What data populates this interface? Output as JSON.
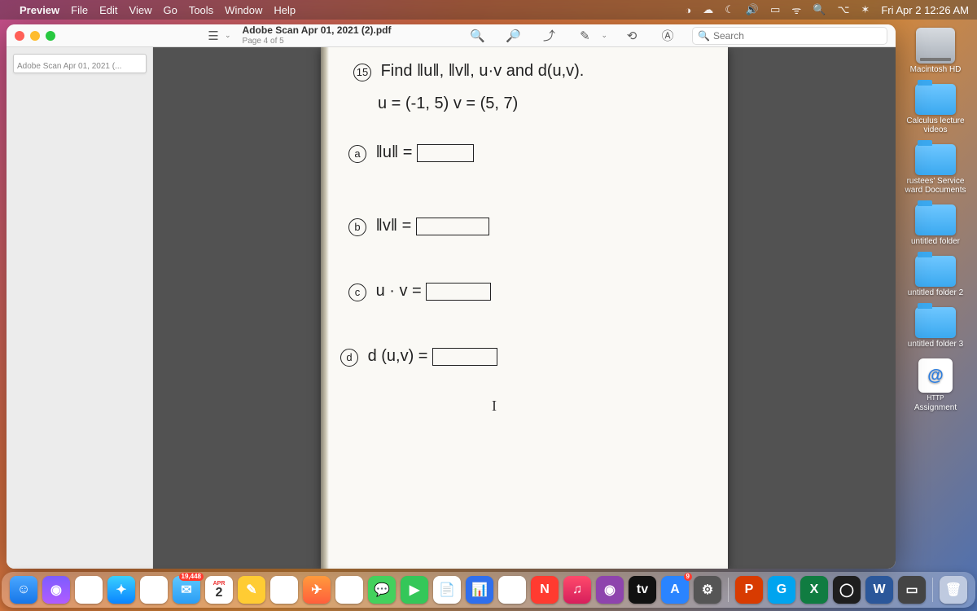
{
  "menubar": {
    "app": "Preview",
    "items": [
      "File",
      "Edit",
      "View",
      "Go",
      "Tools",
      "Window",
      "Help"
    ],
    "clock": "Fri Apr 2  12:26 AM"
  },
  "window": {
    "title": "Adobe Scan Apr 01, 2021 (2).pdf",
    "subtitle": "Page 4 of 5",
    "search_placeholder": "Search",
    "sidebar_thumb_label": "Adobe Scan Apr 01, 2021 (..."
  },
  "document": {
    "q_number": "15",
    "q_line1": "Find  ‖u‖,   ‖v‖,  u·v  and  d(u,v).",
    "q_line2": "u = (-1, 5)    v = (5, 7)",
    "part_a_label": "a",
    "part_a_text": "‖u‖ =",
    "part_b_label": "b",
    "part_b_text": "‖v‖ =",
    "part_c_label": "c",
    "part_c_text": "u · v =",
    "part_d_label": "d",
    "part_d_text": "d (u,v)  ="
  },
  "desktop": {
    "items": [
      {
        "kind": "hd",
        "label": "Macintosh HD"
      },
      {
        "kind": "folder",
        "label": "Calculus lecture videos"
      },
      {
        "kind": "folder",
        "label": "rustees' Service ward Documents"
      },
      {
        "kind": "folder",
        "label": "untitled folder"
      },
      {
        "kind": "folder",
        "label": "untitled folder 2"
      },
      {
        "kind": "folder",
        "label": "untitled folder 3"
      },
      {
        "kind": "doc",
        "glyph": "@",
        "sub": "HTTP",
        "label": "Assignment"
      }
    ]
  },
  "dock": {
    "mail_badge": "19,448",
    "cal_month": "APR",
    "cal_day": "2",
    "appstore_badge": "9"
  }
}
